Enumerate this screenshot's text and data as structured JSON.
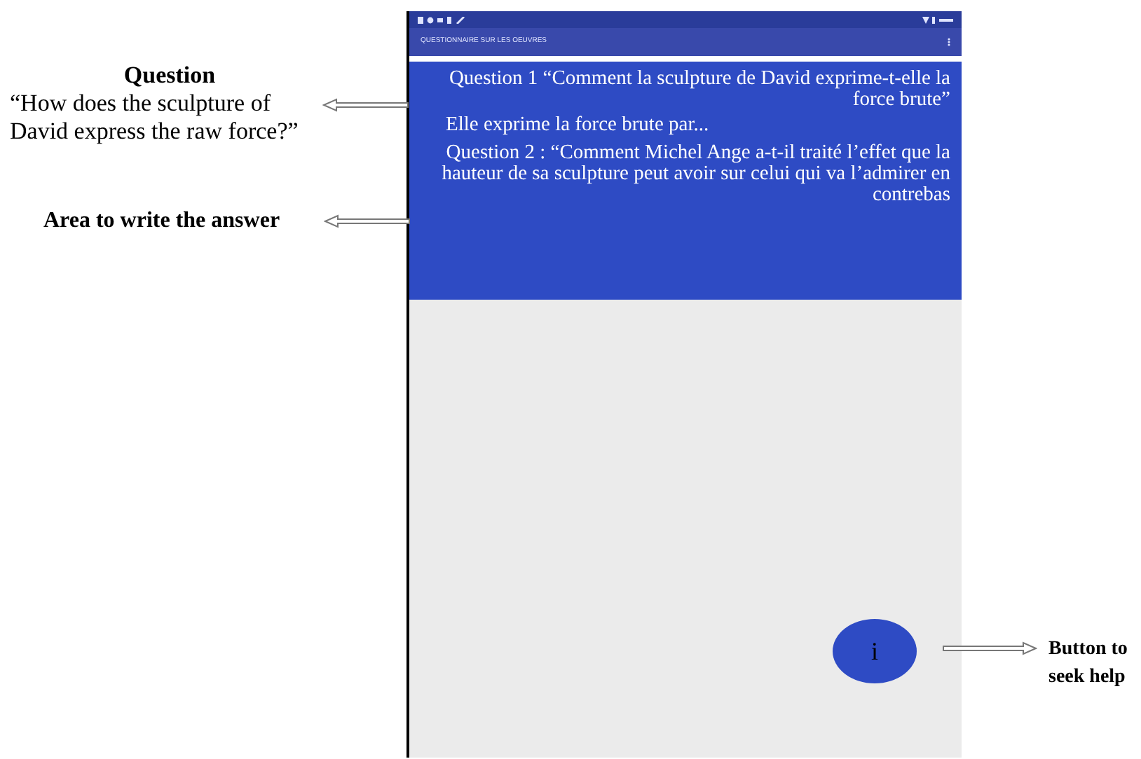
{
  "annotations": [
    {
      "kind": "question",
      "title": "Question",
      "text": "“How does the sculpture of David express the raw force?”"
    },
    {
      "kind": "answer",
      "text": "Area to write the answer"
    },
    {
      "kind": "help",
      "text": "Button to seek help"
    }
  ],
  "app": {
    "title": "QUESTIONNAIRE SUR LES OEUVRES",
    "questions": [
      {
        "label": "Question 1 “Comment la sculpture de David exprime-t-elle la force brute”",
        "answer": "Elle exprime la force brute par..."
      },
      {
        "label": "Question 2 : “Comment Michel Ange a-t-il traité l’effet que la hauteur de sa sculpture peut avoir sur celui qui va l’admirer en contrebas"
      }
    ],
    "help_button": "i"
  }
}
